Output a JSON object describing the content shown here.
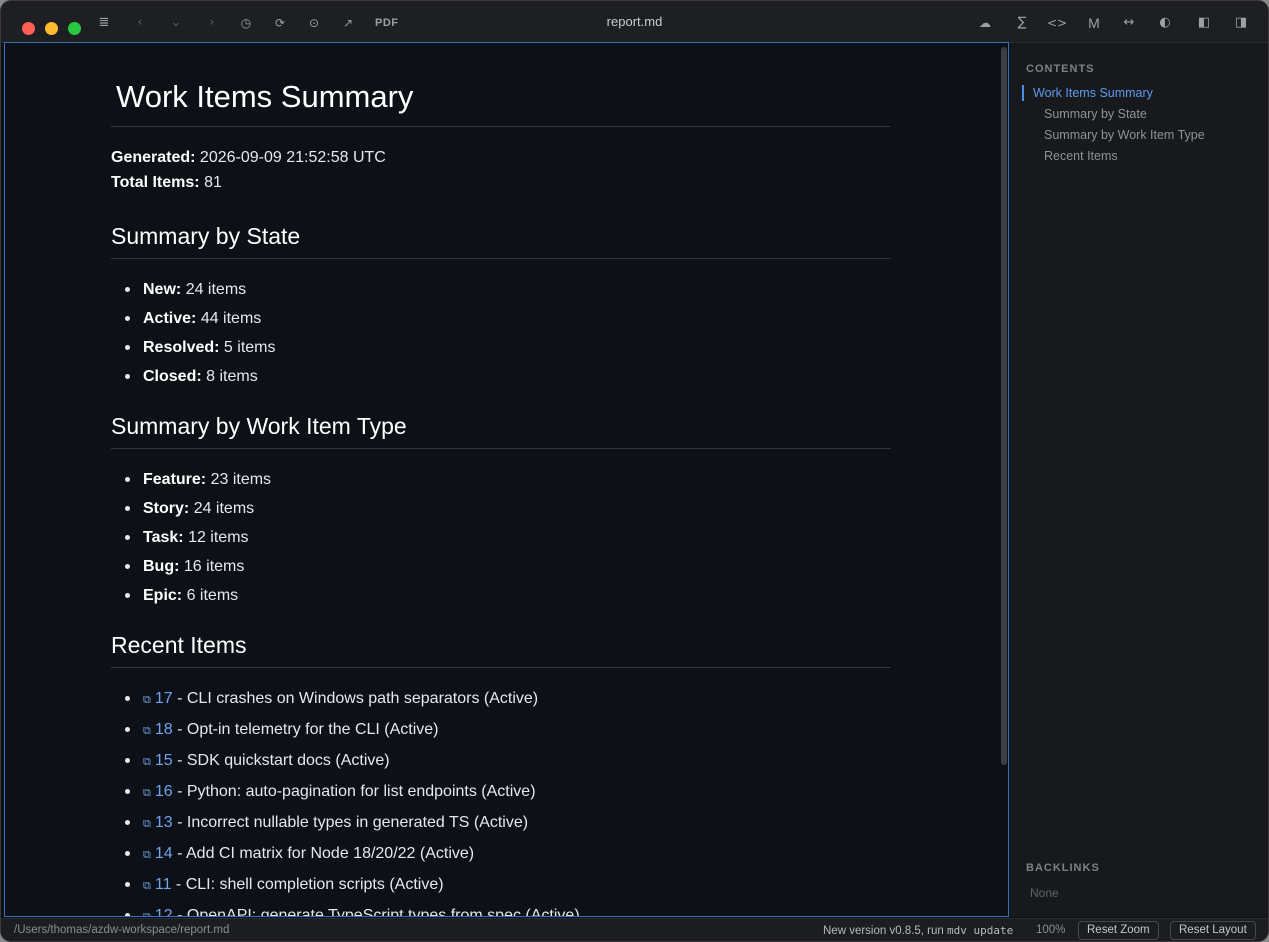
{
  "window": {
    "title": "report.md"
  },
  "toolbar": {
    "sidebar_toggle_icon": "list-icon",
    "back_icon": "chevron-left-icon",
    "history_icon": "chevron-down-icon",
    "forward_icon": "chevron-right-icon",
    "pdf_label": "PDF",
    "right_icons": [
      "cloud-icon",
      "sigma-icon",
      "code-icon",
      "markdown-icon",
      "width-icon",
      "theme-icon",
      "left-panel-icon",
      "right-panel-icon"
    ]
  },
  "document": {
    "title": "Work Items Summary",
    "meta": {
      "generated_label": "Generated:",
      "generated_value": "2026-09-09 21:52:58 UTC",
      "total_label": "Total Items:",
      "total_value": "81"
    },
    "sections": {
      "by_state": {
        "heading": "Summary by State",
        "items": [
          {
            "label": "New:",
            "value": "24 items"
          },
          {
            "label": "Active:",
            "value": "44 items"
          },
          {
            "label": "Resolved:",
            "value": "5 items"
          },
          {
            "label": "Closed:",
            "value": "8 items"
          }
        ]
      },
      "by_type": {
        "heading": "Summary by Work Item Type",
        "items": [
          {
            "label": "Feature:",
            "value": "23 items"
          },
          {
            "label": "Story:",
            "value": "24 items"
          },
          {
            "label": "Task:",
            "value": "12 items"
          },
          {
            "label": "Bug:",
            "value": "16 items"
          },
          {
            "label": "Epic:",
            "value": "6 items"
          }
        ]
      },
      "recent": {
        "heading": "Recent Items",
        "items": [
          {
            "id": "17",
            "text": " - CLI crashes on Windows path separators (Active)"
          },
          {
            "id": "18",
            "text": " - Opt-in telemetry for the CLI (Active)"
          },
          {
            "id": "15",
            "text": " - SDK quickstart docs (Active)"
          },
          {
            "id": "16",
            "text": " - Python: auto-pagination for list endpoints (Active)"
          },
          {
            "id": "13",
            "text": " - Incorrect nullable types in generated TS (Active)"
          },
          {
            "id": "14",
            "text": " - Add CI matrix for Node 18/20/22 (Active)"
          },
          {
            "id": "11",
            "text": " - CLI: shell completion scripts (Active)"
          },
          {
            "id": "12",
            "text": " - OpenAPI: generate TypeScript types from spec (Active)"
          }
        ]
      }
    }
  },
  "sidebar": {
    "contents_heading": "CONTENTS",
    "toc": [
      {
        "label": "Work Items Summary"
      },
      {
        "label": "Summary by State"
      },
      {
        "label": "Summary by Work Item Type"
      },
      {
        "label": "Recent Items"
      }
    ],
    "backlinks_heading": "BACKLINKS",
    "backlinks_empty": "None"
  },
  "statusbar": {
    "path": "/Users/thomas/azdw-workspace/report.md",
    "update_prefix": "New version v0.8.5, run ",
    "update_cmd": "mdv  update",
    "zoom": "100%",
    "reset_zoom": "Reset Zoom",
    "reset_layout": "Reset Layout"
  },
  "colors": {
    "accent": "#4a8ef0",
    "link": "#6ea4f0",
    "background": "#0d1117"
  }
}
